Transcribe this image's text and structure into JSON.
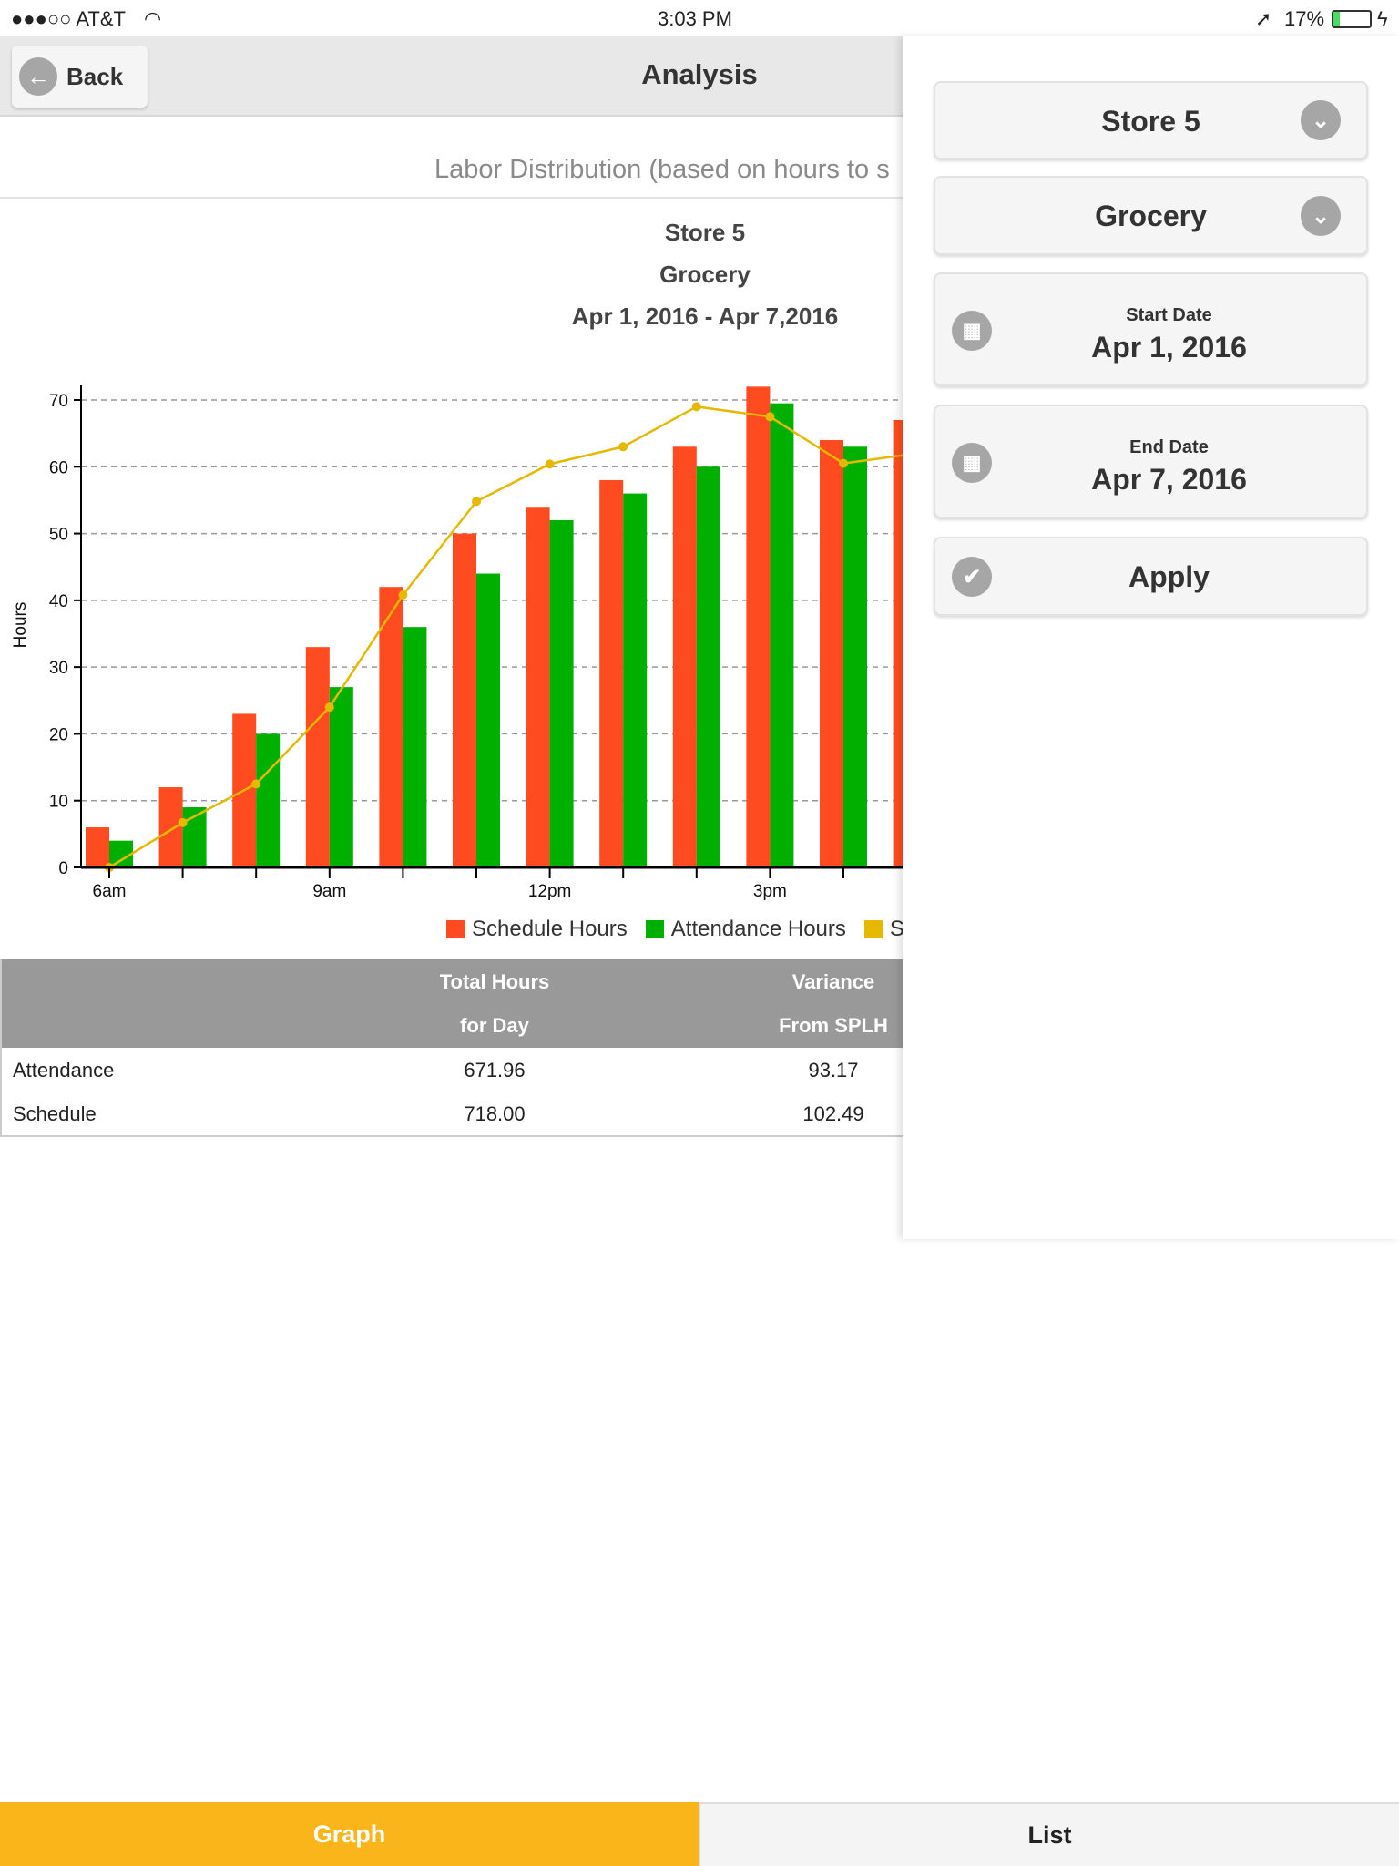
{
  "status_bar": {
    "carrier": "●●●○○ AT&T",
    "time": "3:03 PM",
    "battery": "17%"
  },
  "nav": {
    "back_label": "Back",
    "title": "Analysis"
  },
  "subtitle": "Labor Distribution (based on hours to s",
  "chart_header": {
    "store": "Store 5",
    "department": "Grocery",
    "date_range": "Apr 1, 2016 - Apr 7,2016"
  },
  "chart_data": {
    "type": "bar",
    "ylabel": "Hours",
    "ylim": [
      0,
      70
    ],
    "yticks": [
      0,
      10,
      20,
      30,
      40,
      50,
      60,
      70
    ],
    "grid": true,
    "legend_position": "bottom",
    "categories": [
      "6am",
      "7am",
      "8am",
      "9am",
      "10am",
      "11am",
      "12pm",
      "1pm",
      "2pm",
      "3pm",
      "4pm",
      "5pm"
    ],
    "tick_labels": [
      "6am",
      "",
      "",
      "9am",
      "",
      "",
      "12pm",
      "",
      "",
      "3pm",
      "",
      ""
    ],
    "series": [
      {
        "name": "Schedule Hours",
        "type": "bar",
        "color": "#ff4b1f",
        "values": [
          6,
          12,
          23,
          33,
          42,
          50,
          54,
          58,
          63,
          72,
          64,
          67
        ]
      },
      {
        "name": "Attendance Hours",
        "type": "bar",
        "color": "#00b000",
        "values": [
          4,
          9,
          20,
          27,
          36,
          44,
          52,
          56,
          60,
          69.5,
          63,
          null
        ]
      },
      {
        "name": "S",
        "type": "line",
        "color": "#e6b800",
        "values": [
          0,
          6.7,
          12.5,
          24,
          40.8,
          54.8,
          60.4,
          63,
          69,
          67.5,
          60.5,
          62
        ]
      }
    ]
  },
  "table": {
    "headers": [
      {
        "line1": "",
        "line2": ""
      },
      {
        "line1": "Total Hours",
        "line2": "for Day"
      },
      {
        "line1": "Variance",
        "line2": "From SPLH"
      }
    ],
    "rows": [
      {
        "label": "Attendance",
        "total": "671.96",
        "variance": "93.17"
      },
      {
        "label": "Schedule",
        "total": "718.00",
        "variance": "102.49"
      }
    ]
  },
  "panel": {
    "store": "Store 5",
    "department": "Grocery",
    "start_label": "Start Date",
    "start_value": "Apr 1, 2016",
    "end_label": "End Date",
    "end_value": "Apr 7, 2016",
    "apply_label": "Apply"
  },
  "tabs": [
    {
      "label": "Graph",
      "active": true,
      "color": "#f9b51a"
    },
    {
      "label": "List",
      "active": false
    }
  ]
}
